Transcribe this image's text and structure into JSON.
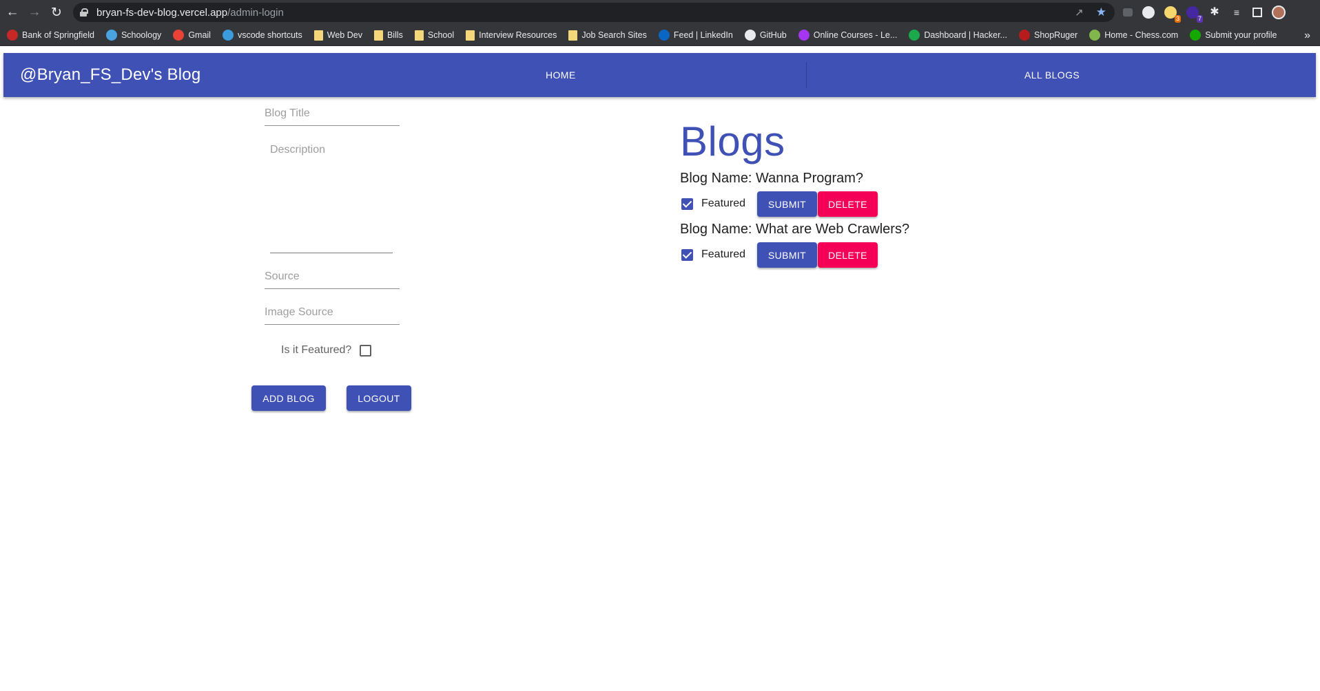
{
  "browser": {
    "url_host": "bryan-fs-dev-blog.vercel.app",
    "url_path": "/admin-login",
    "bookmarks": [
      {
        "label": "Bank of Springfield",
        "icon": "bank-icon",
        "color": "#c62828"
      },
      {
        "label": "Schoology",
        "icon": "schoology-icon",
        "color": "#4aa3df"
      },
      {
        "label": "Gmail",
        "icon": "gmail-icon",
        "color": "#ea4335"
      },
      {
        "label": "vscode shortcuts",
        "icon": "vscode-icon",
        "color": "#3b9bdc"
      },
      {
        "label": "Web Dev",
        "icon": "folder-icon",
        "color": "#f3d77a"
      },
      {
        "label": "Bills",
        "icon": "folder-icon",
        "color": "#f3d77a"
      },
      {
        "label": "School",
        "icon": "folder-icon",
        "color": "#f3d77a"
      },
      {
        "label": "Interview Resources",
        "icon": "folder-icon",
        "color": "#f3d77a"
      },
      {
        "label": "Job Search Sites",
        "icon": "folder-icon",
        "color": "#f3d77a"
      },
      {
        "label": "Feed | LinkedIn",
        "icon": "linkedin-icon",
        "color": "#0a66c2"
      },
      {
        "label": "GitHub",
        "icon": "github-icon",
        "color": "#e8eaed"
      },
      {
        "label": "Online Courses - Le...",
        "icon": "udemy-icon",
        "color": "#a435f0"
      },
      {
        "label": "Dashboard | Hacker...",
        "icon": "hackerrank-icon",
        "color": "#1ba94c"
      },
      {
        "label": "ShopRuger",
        "icon": "ruger-icon",
        "color": "#b71c1c"
      },
      {
        "label": "Home - Chess.com",
        "icon": "chess-icon",
        "color": "#81b64c"
      },
      {
        "label": "Submit your profile",
        "icon": "upwork-icon",
        "color": "#14a800"
      }
    ],
    "bookmarks_more": "»",
    "extension_badges": [
      "3",
      "7"
    ]
  },
  "app_bar": {
    "title": "@Bryan_FS_Dev's Blog",
    "nav_home": "HOME",
    "nav_all_blogs": "ALL BLOGS",
    "color": "#3f51b5"
  },
  "form": {
    "title_placeholder": "Blog Title",
    "description_placeholder": "Description",
    "source_placeholder": "Source",
    "image_source_placeholder": "Image Source",
    "featured_label": "Is it Featured?",
    "featured_checked": false,
    "add_blog_label": "ADD BLOG",
    "logout_label": "LOGOUT"
  },
  "blogs": {
    "heading": "Blogs",
    "items": [
      {
        "name": "Blog Name: Wanna Program?",
        "featured_label": "Featured",
        "featured_checked": true,
        "submit_label": "SUBMIT",
        "delete_label": "DELETE"
      },
      {
        "name": "Blog Name: What are Web Crawlers?",
        "featured_label": "Featured",
        "featured_checked": true,
        "submit_label": "SUBMIT",
        "delete_label": "DELETE"
      }
    ]
  },
  "colors": {
    "primary": "#3f51b5",
    "secondary": "#f50057"
  }
}
